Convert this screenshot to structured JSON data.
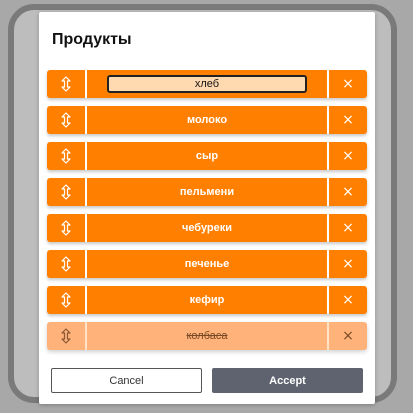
{
  "dialog": {
    "title": "Продукты"
  },
  "items": [
    {
      "label": "хлеб",
      "editing": true,
      "disabled": false
    },
    {
      "label": "молоко",
      "editing": false,
      "disabled": false
    },
    {
      "label": "сыр",
      "editing": false,
      "disabled": false
    },
    {
      "label": "пельмени",
      "editing": false,
      "disabled": false
    },
    {
      "label": "чебуреки",
      "editing": false,
      "disabled": false
    },
    {
      "label": "печенье",
      "editing": false,
      "disabled": false
    },
    {
      "label": "кефир",
      "editing": false,
      "disabled": false
    },
    {
      "label": "колбаса",
      "editing": false,
      "disabled": true
    }
  ],
  "remove_symbol": "×",
  "buttons": {
    "cancel_label": "Cancel",
    "accept_label": "Accept"
  },
  "colors": {
    "row": "#ff7f00",
    "row_disabled": "#ffb27a",
    "accept": "#5f6370"
  },
  "icons": {
    "drag": "up-down-arrow-icon",
    "remove": "close-icon"
  }
}
